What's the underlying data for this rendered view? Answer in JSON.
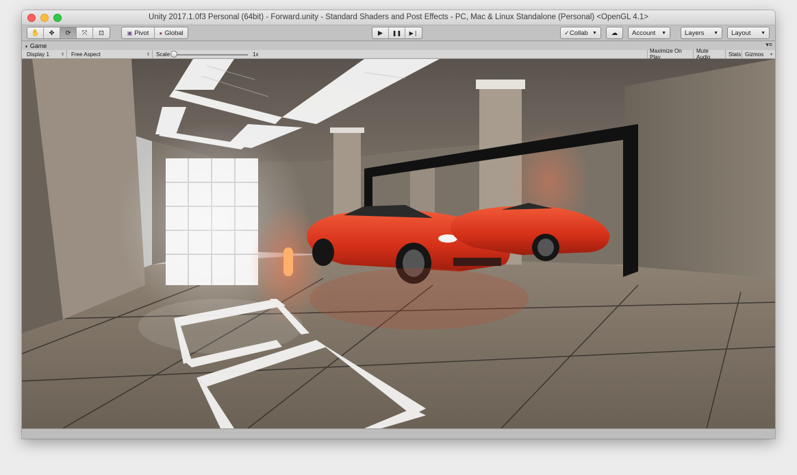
{
  "window": {
    "title": "Unity 2017.1.0f3 Personal (64bit) - Forward.unity - Standard Shaders and Post Effects - PC, Mac & Linux Standalone (Personal) <OpenGL 4.1>"
  },
  "toolbar": {
    "transform_tools": [
      {
        "name": "hand-tool",
        "icon": "hand-icon",
        "glyph": "✋"
      },
      {
        "name": "move-tool",
        "icon": "move-icon",
        "glyph": "✥"
      },
      {
        "name": "rotate-tool",
        "icon": "rotate-icon",
        "glyph": "⟳"
      },
      {
        "name": "scale-tool",
        "icon": "scale-icon",
        "glyph": "⤧"
      },
      {
        "name": "rect-tool",
        "icon": "rect-tool-icon",
        "glyph": "⊡"
      }
    ],
    "active_tool": "rotate-tool",
    "pivot_label": "Pivot",
    "global_label": "Global",
    "play_glyph": "▶",
    "pause_glyph": "❚❚",
    "step_glyph": "▶❘",
    "collab_label": "Collab",
    "cloud_glyph": "☁",
    "account_label": "Account",
    "layers_label": "Layers",
    "layout_label": "Layout"
  },
  "game_tab": {
    "title": "Game",
    "display": "Display 1",
    "aspect": "Free Aspect",
    "scale_label": "Scale",
    "scale_value": "1x",
    "maximize_on_play": "Maximize On Play",
    "mute_audio": "Mute Audio",
    "stats": "Stats",
    "gizmos": "Gizmos"
  },
  "colors": {
    "car_red": "#d8321b",
    "floor": "#7d7366",
    "wall": "#8a8074"
  }
}
